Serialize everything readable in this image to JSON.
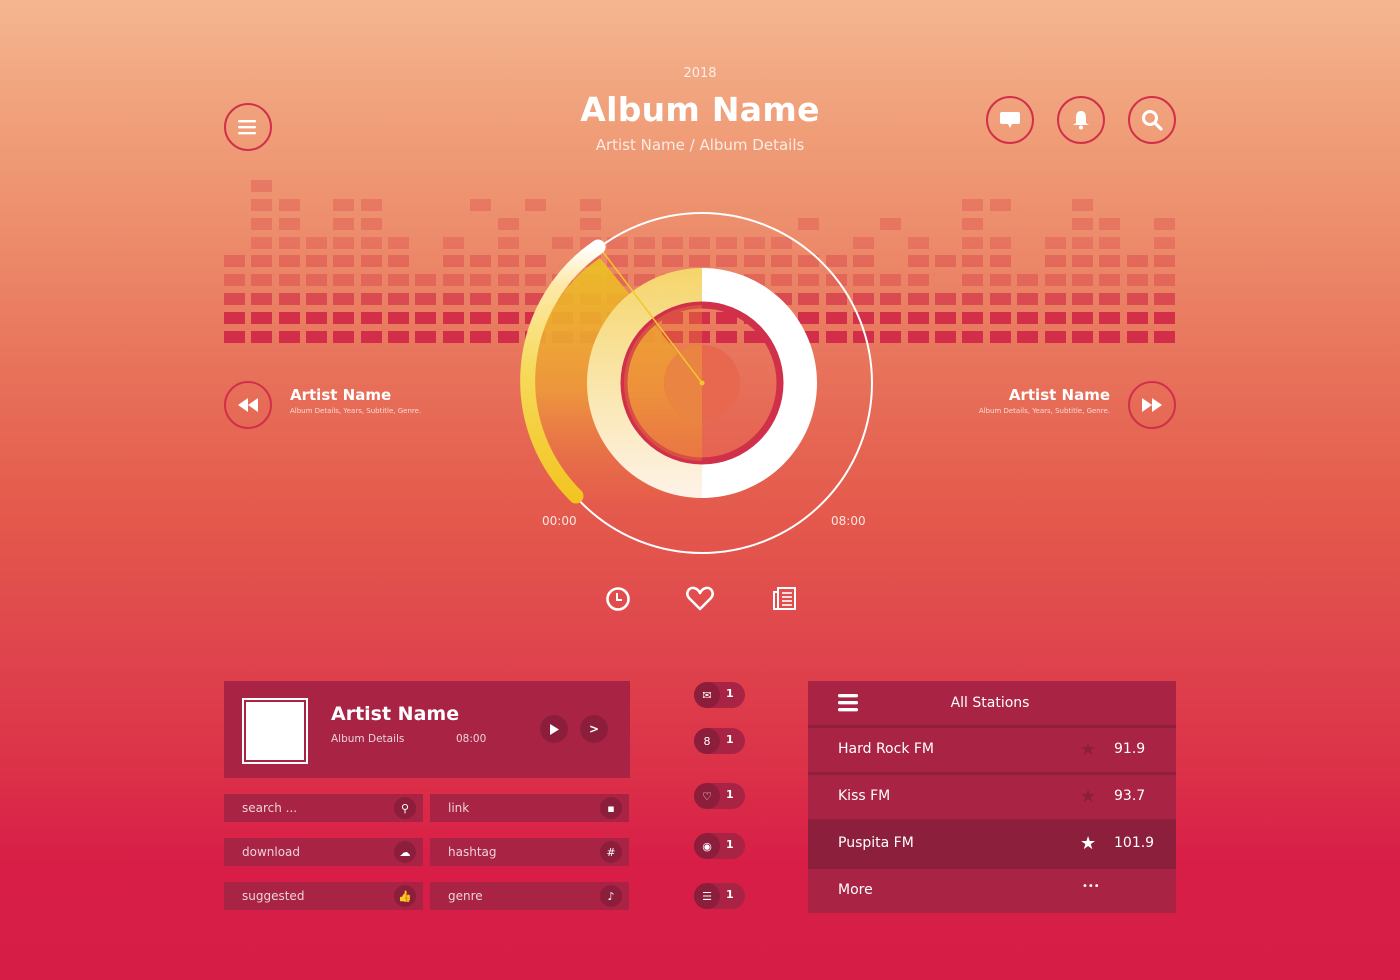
{
  "header": {
    "year": "2018",
    "album_name": "Album Name",
    "subtitle": "Artist Name / Album Details",
    "menu_icon": "hamburger-menu-icon",
    "actions": [
      {
        "name": "messages",
        "icon": "chat-bubble-icon"
      },
      {
        "name": "notifications",
        "icon": "bell-icon"
      },
      {
        "name": "search",
        "icon": "search-icon"
      }
    ]
  },
  "equalizer": {
    "levels": [
      4,
      8,
      7,
      5,
      7,
      7,
      5,
      3,
      5,
      5,
      6,
      5,
      4,
      7,
      5,
      5,
      5,
      5,
      5,
      5,
      5,
      5,
      4,
      5,
      4,
      5,
      3,
      7,
      6,
      3,
      5,
      7,
      6,
      4,
      6
    ],
    "peaks": [
      5,
      9,
      8,
      6,
      8,
      8,
      6,
      4,
      6,
      8,
      7,
      8,
      6,
      8,
      6,
      6,
      6,
      6,
      6,
      6,
      6,
      7,
      5,
      6,
      7,
      6,
      5,
      8,
      8,
      4,
      6,
      8,
      7,
      5,
      7
    ]
  },
  "player": {
    "prev": {
      "artist": "Artist Name",
      "details": "Album Details, Years, Subtitle, Genre."
    },
    "next": {
      "artist": "Artist Name",
      "details": "Album Details, Years, Subtitle, Genre."
    },
    "time_start": "00:00",
    "time_end": "08:00",
    "progress": 0.3,
    "colors": {
      "accent": "#f1c82a",
      "ring": "#d0304a"
    }
  },
  "controls": [
    {
      "name": "history",
      "icon": "clock-icon"
    },
    {
      "name": "favorite",
      "icon": "heart-icon"
    },
    {
      "name": "playlist",
      "icon": "list-document-icon"
    }
  ],
  "now_playing": {
    "artist": "Artist Name",
    "details": "Album Details",
    "duration": "08:00",
    "play_icon": "play-icon",
    "next_label": ">"
  },
  "fields": [
    {
      "label": "search ...",
      "icon": "search-icon",
      "glyph": "⚲"
    },
    {
      "label": "link",
      "icon": "grid-icon",
      "glyph": "▪"
    },
    {
      "label": "download",
      "icon": "cloud-download-icon",
      "glyph": "☁"
    },
    {
      "label": "hashtag",
      "icon": "hashtag-icon",
      "glyph": "#"
    },
    {
      "label": "suggested",
      "icon": "thumbs-up-icon",
      "glyph": "👍"
    },
    {
      "label": "genre",
      "icon": "music-note-icon",
      "glyph": "♪"
    }
  ],
  "badges": [
    {
      "icon": "mail-icon",
      "glyph": "✉",
      "count": "1"
    },
    {
      "icon": "user-icon",
      "glyph": "8",
      "count": "1"
    },
    {
      "icon": "heart-icon",
      "glyph": "♡",
      "count": "1"
    },
    {
      "icon": "record-icon",
      "glyph": "◉",
      "count": "1"
    },
    {
      "icon": "list-icon",
      "glyph": "☰",
      "count": "1"
    }
  ],
  "stations": {
    "title": "All Stations",
    "items": [
      {
        "name": "Hard Rock FM",
        "freq": "91.9",
        "starred": false
      },
      {
        "name": "Kiss FM",
        "freq": "93.7",
        "starred": false
      },
      {
        "name": "Puspita FM",
        "freq": "101.9",
        "starred": true
      }
    ],
    "more_label": "More",
    "more_glyph": "•••"
  }
}
